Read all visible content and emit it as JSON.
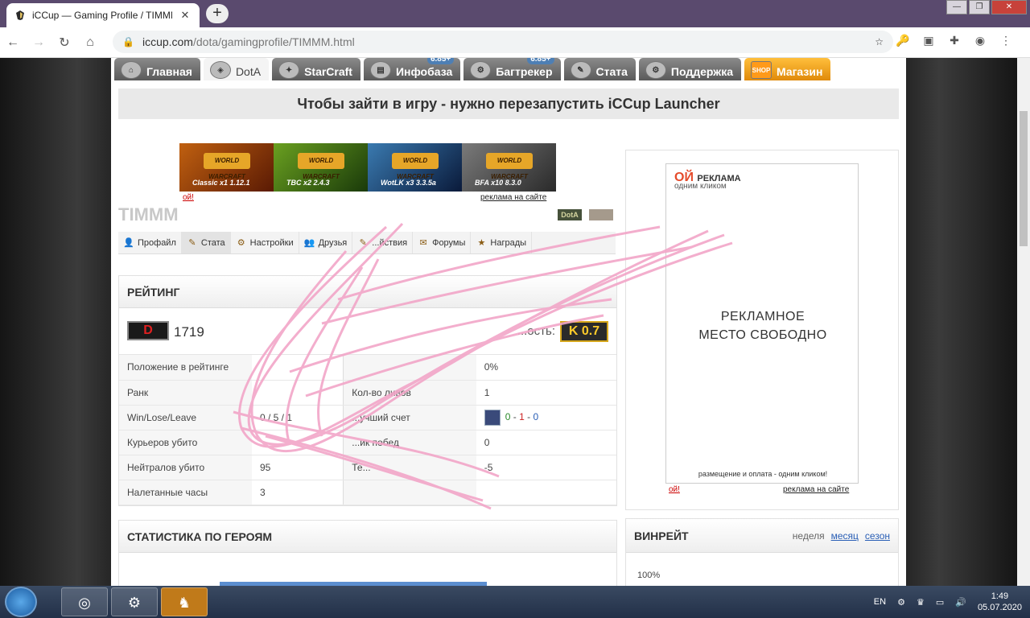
{
  "browser": {
    "tab_title": "iCCup — Gaming Profile / TIMMM",
    "url_host": "iccup.com",
    "url_path": "/dota/gamingprofile/TIMMM.html"
  },
  "topnav": [
    {
      "label": "Главная",
      "badge": ""
    },
    {
      "label": "DotA",
      "badge": ""
    },
    {
      "label": "StarCraft",
      "badge": ""
    },
    {
      "label": "Инфобаза",
      "badge": "6.85+"
    },
    {
      "label": "Багтрекер",
      "badge": "6.85+"
    },
    {
      "label": "Стата",
      "badge": ""
    },
    {
      "label": "Поддержка",
      "badge": ""
    },
    {
      "label": "Магазин",
      "badge": "SHOP"
    }
  ],
  "notice": "Чтобы зайти в игру - нужно перезапустить iCCup Launcher",
  "banner": {
    "slots": [
      "Classic x1 1.12.1",
      "TBC x2 2.4.3",
      "WotLK x3 3.3.5a",
      "BFA x10 8.3.0"
    ],
    "wc_text": "WORLD WARCRAFT",
    "oy": "ой!",
    "ad_link": "реклама на сайте"
  },
  "profile": {
    "username": "TIMMM",
    "game_badge": "DotA"
  },
  "subnav": [
    "Профайл",
    "Стата",
    "Настройки",
    "Друзья",
    "...йствия",
    "Форумы",
    "Награды"
  ],
  "rating": {
    "title": "РЕЙТИНГ",
    "rank_letter": "D",
    "points": "1719",
    "k_label": "...ость:",
    "k_value": "K 0.7",
    "rows": [
      [
        "Положение в рейтинге",
        "",
        "",
        "0%"
      ],
      [
        "Ранк",
        "",
        "Кол-во ливов",
        "1"
      ],
      [
        "Win/Lose/Leave",
        "0 / 5 / 1",
        "...учший счет",
        "score"
      ],
      [
        "Курьеров убито",
        "",
        "...ик побед",
        "0"
      ],
      [
        "Нейтралов убито",
        "95",
        "Те...",
        "-5"
      ],
      [
        "Налетанные часы",
        "3",
        "",
        ""
      ]
    ],
    "best_score": {
      "g": "0",
      "r": "1",
      "b": "0"
    }
  },
  "heroes": {
    "title": "СТАТИСТИКА ПО ГЕРОЯМ"
  },
  "right_ad": {
    "logo": "ОЙ",
    "logo_main": "РЕКЛАМА",
    "logo_sub": "одним кликом",
    "free_line1": "РЕКЛАМНОЕ",
    "free_line2": "МЕСТО СВОБОДНО",
    "footer": "размещение и оплата - одним кликом!",
    "oy": "ой!",
    "ad_link": "реклама на сайте"
  },
  "winrate": {
    "title": "ВИНРЕЙТ",
    "tabs": [
      "неделя",
      "месяц",
      "сезон"
    ],
    "pct": "100%"
  },
  "tray": {
    "lang": "EN",
    "time": "1:49",
    "date": "05.07.2020"
  },
  "colors": {
    "accent_blue": "#2a5fb6",
    "k_gold": "#d6a71c",
    "rank_red": "#e02020",
    "scribble_pink": "#f2a6c8"
  }
}
